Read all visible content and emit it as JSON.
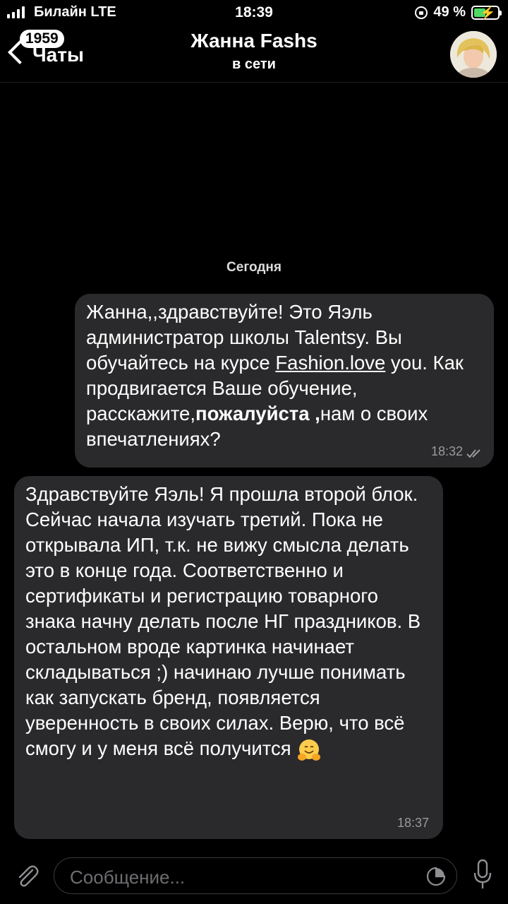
{
  "status_bar": {
    "carrier": "Билайн  LTE",
    "time": "18:39",
    "battery": "49 %",
    "battery_level": 0.49
  },
  "header": {
    "back_label": "Чаты",
    "unread_count": "1959",
    "title": "Жанна Fashs",
    "status": "в сети"
  },
  "date_separator": "Сегодня",
  "messages": [
    {
      "direction": "outgoing",
      "parts": {
        "p1": "Жанна,,здравствуйте! Это Яэль администратор школы Talentsy. Вы обучайтесь на курсе ",
        "link": "Fashion.love",
        "p2": " you. Как продвигается Ваше обучение, расскажите,",
        "bold": "пожалуйста ,",
        "p3": "нам о своих впечатлениях?"
      },
      "time": "18:32",
      "read": true
    },
    {
      "direction": "incoming",
      "text": "Здравствуйте Яэль! Я прошла второй блок. Сейчас начала изучать третий. Пока не открывала ИП, т.к. не вижу смысла делать это в конце года. Соответственно и сертификаты и регистрацию товарного знака начну делать после НГ праздников. В остальном вроде картинка начинает складываться ;) начинаю лучше понимать как запускать бренд, появляется уверенность в своих силах. Верю, что всё смогу и у меня всё получится",
      "emoji": "hugging-face",
      "time": "18:37"
    }
  ],
  "input": {
    "placeholder": "Сообщение..."
  },
  "colors": {
    "background": "#000000",
    "bubble": "#2a2a2c",
    "battery_fill": "#4cd964"
  }
}
